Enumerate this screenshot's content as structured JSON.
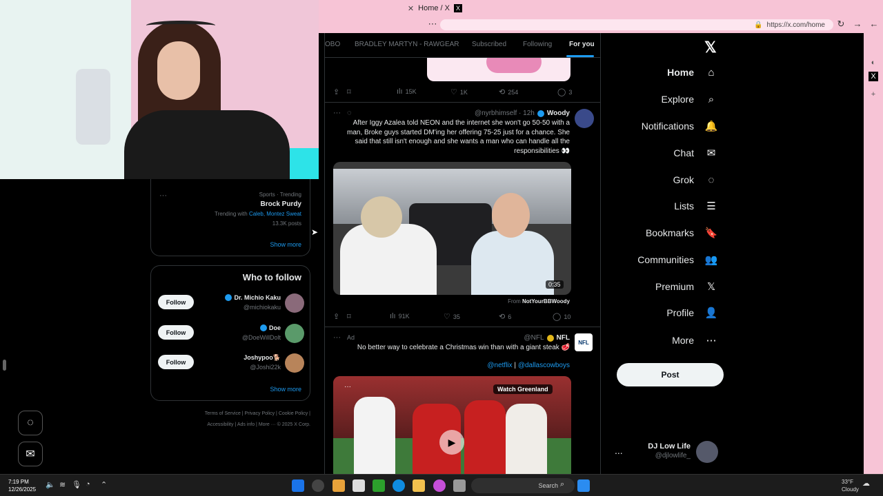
{
  "browser": {
    "tab_title": "Home / X",
    "tab_close": "✕",
    "url": "https://x.com/home",
    "x_icon": "x-logo-icon"
  },
  "nav": {
    "logo": "𝕏",
    "items": [
      {
        "label": "Home",
        "icon": "⌂"
      },
      {
        "label": "Explore",
        "icon": "⌕"
      },
      {
        "label": "Notifications",
        "icon": "🔔"
      },
      {
        "label": "Chat",
        "icon": "✉"
      },
      {
        "label": "Grok",
        "icon": "◌"
      },
      {
        "label": "Lists",
        "icon": "☰"
      },
      {
        "label": "Bookmarks",
        "icon": "🔖"
      },
      {
        "label": "Communities",
        "icon": "👥"
      },
      {
        "label": "Premium",
        "icon": "𝕏"
      },
      {
        "label": "Profile",
        "icon": "👤"
      },
      {
        "label": "More",
        "icon": "⋯"
      }
    ],
    "post_label": "Post",
    "account": {
      "name": "DJ Low Life",
      "handle": "@djlowlife_",
      "more": "..."
    }
  },
  "feed": {
    "tabs": [
      "For you",
      "Following",
      "Subscribed",
      "BRADLEY MARTYN - RAWGEAR",
      "OBO"
    ],
    "tweet0_actions": {
      "reply": "3",
      "retweet": "254",
      "like": "1K",
      "views": "15K"
    },
    "tweet1": {
      "name": "Woody",
      "handle": "@nyrbhimself · 12h",
      "text": "After Iggy Azalea told NEON and the internet she won't go 50-50 with a man, Broke guys started DM'ing her offering 75-25 just for a chance. She said that still isn't enough and she wants a man who can handle all the responsibilities 👀",
      "duration": "0:35",
      "from_prefix": "From",
      "from_name": "NotYourBBWoody",
      "actions": {
        "reply": "10",
        "retweet": "6",
        "like": "35",
        "views": "91K"
      }
    },
    "tweet2": {
      "name": "NFL",
      "handle": "@NFL",
      "ad": "Ad",
      "text": "No better way to celebrate a Christmas win than with a giant steak 🥩",
      "link1": "@dallascowboys",
      "link_sep": " | ",
      "link2": "@netflix",
      "badge": "Watch Greenland",
      "logo": "NFL"
    }
  },
  "sidebar_right": {
    "trend_category": "Sports · Trending",
    "trend_title": "Brock Purdy",
    "trend_with_prefix": "Trending with",
    "trend_with_links": "Caleb, Montez Sweat",
    "trend_count": "13.3K posts",
    "show_more": "Show more",
    "wtf_title": "Who to follow",
    "follow_label": "Follow",
    "suggestions": [
      {
        "name": "Dr. Michio Kaku",
        "handle": "@michiokaku"
      },
      {
        "name": "Doe",
        "handle": "@DoeWillDolt"
      },
      {
        "name": "Joshypoo🐕",
        "handle": "@Joshi22k"
      }
    ],
    "footer1": "Terms of Service  |  Privacy Policy  |  Cookie Policy  |",
    "footer2": "Accessibility  |  Ads info  |  More ···  © 2025 X Corp."
  },
  "taskbar": {
    "time": "7:19 PM",
    "date": "12/26/2025",
    "search_label": "Search",
    "weather_temp": "33°F",
    "weather_desc": "Cloudy"
  },
  "colors": {
    "accent": "#1d9bf0",
    "chrome": "#f7c4d6",
    "background": "#000000"
  }
}
